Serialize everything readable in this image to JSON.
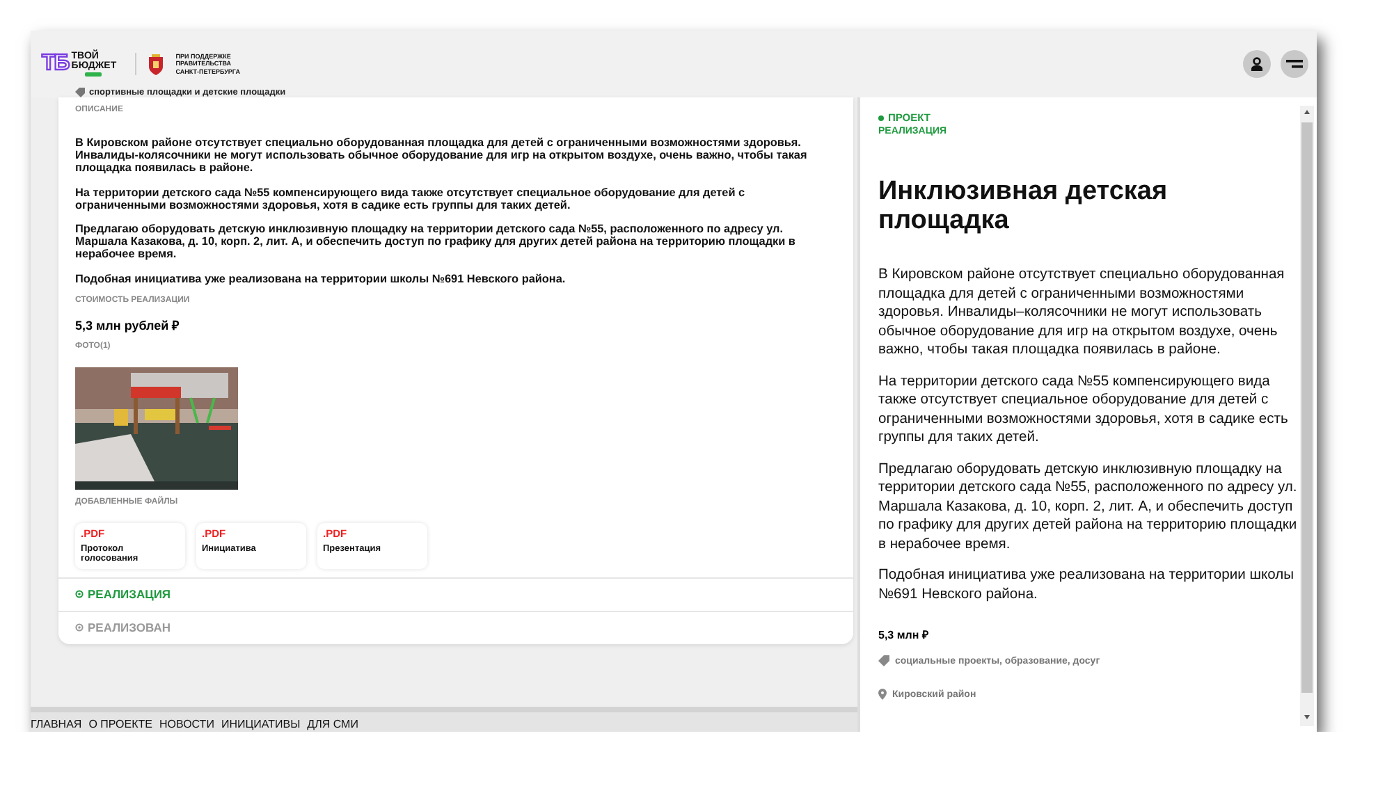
{
  "header": {
    "logo_mark": "ТБ",
    "logo_text": "ТВОЙ БЮДЖЕТ",
    "support_lines": [
      "ПРИ ПОДДЕРЖКЕ",
      "ПРАВИТЕЛЬСТВА",
      "САНКТ-ПЕТЕРБУРГА"
    ]
  },
  "detail": {
    "category": "спортивные площадки и детские площадки",
    "description_label": "ОПИСАНИЕ",
    "paragraphs": [
      "В Кировском районе отсутствует специально оборудованная площадка для детей с ограниченными возможностями здоровья. Инвалиды-колясочники не могут использовать обычное оборудование для игр на открытом воздухе, очень важно, чтобы такая площадка появилась в районе.",
      "На территории детского сада №55 компенсирующего вида также отсутствует специальное оборудование для детей с ограниченными возможностями здоровья, хотя в садике есть группы для таких детей.",
      "Предлагаю оборудовать детскую инклюзивную площадку на территории детского сада №55, расположенного по адресу ул. Маршала Казакова, д. 10, корп. 2, лит. А, и обеспечить доступ по графику для других детей района на территорию площадки в нерабочее время.",
      "Подобная инициатива уже реализована на территории школы №691 Невского района."
    ],
    "cost_label": "СТОИМОСТЬ РЕАЛИЗАЦИИ",
    "cost": "5,3 млн рублей ₽",
    "photos_label": "ФОТО(1)",
    "photo": {
      "kind": "picture"
    },
    "files_label": "ДОБАВЛЕННЫЕ ФАЙЛЫ",
    "files": [
      {
        "ext": ".PDF",
        "name": "Протокол голосования"
      },
      {
        "ext": ".PDF",
        "name": "Инициатива"
      },
      {
        "ext": ".PDF",
        "name": "Презентация"
      }
    ],
    "stages": [
      {
        "label": "РЕАЛИЗАЦИЯ",
        "active": true
      },
      {
        "label": "РЕАЛИЗОВАН",
        "active": false
      }
    ]
  },
  "footer_nav": [
    "ГЛАВНАЯ",
    "О ПРОЕКТЕ",
    "НОВОСТИ",
    "ИНИЦИАТИВЫ",
    "ДЛЯ СМИ"
  ],
  "panel": {
    "status": "ПРОЕКТ",
    "stage": "РЕАЛИЗАЦИЯ",
    "title": "Инклюзивная детская площадка",
    "paragraphs": [
      "В Кировском районе отсутствует специально оборудованная площадка для детей с ограниченными возможностями здоровья. Инвалиды–колясочники не могут использовать обычное оборудование для игр на открытом воздухе, очень важно, чтобы такая площадка появилась в районе.",
      "На территории детского сада №55 компенсирующего вида также отсутствует специальное оборудование для детей с ограниченными возможностями здоровья, хотя в садике есть группы для таких детей.",
      "Предлагаю оборудовать детскую инклюзивную площадку на территории детского сада №55, расположенного по адресу ул. Маршала Казакова, д. 10, корп. 2, лит. А, и обеспечить доступ по графику для других детей района на территорию площадки в нерабочее время.",
      "Подобная инициатива уже реализована на территории школы №691 Невского района."
    ],
    "cost": "5,3 млн ₽",
    "tags": "социальные проекты, образование, досуг",
    "district": "Кировский район"
  }
}
